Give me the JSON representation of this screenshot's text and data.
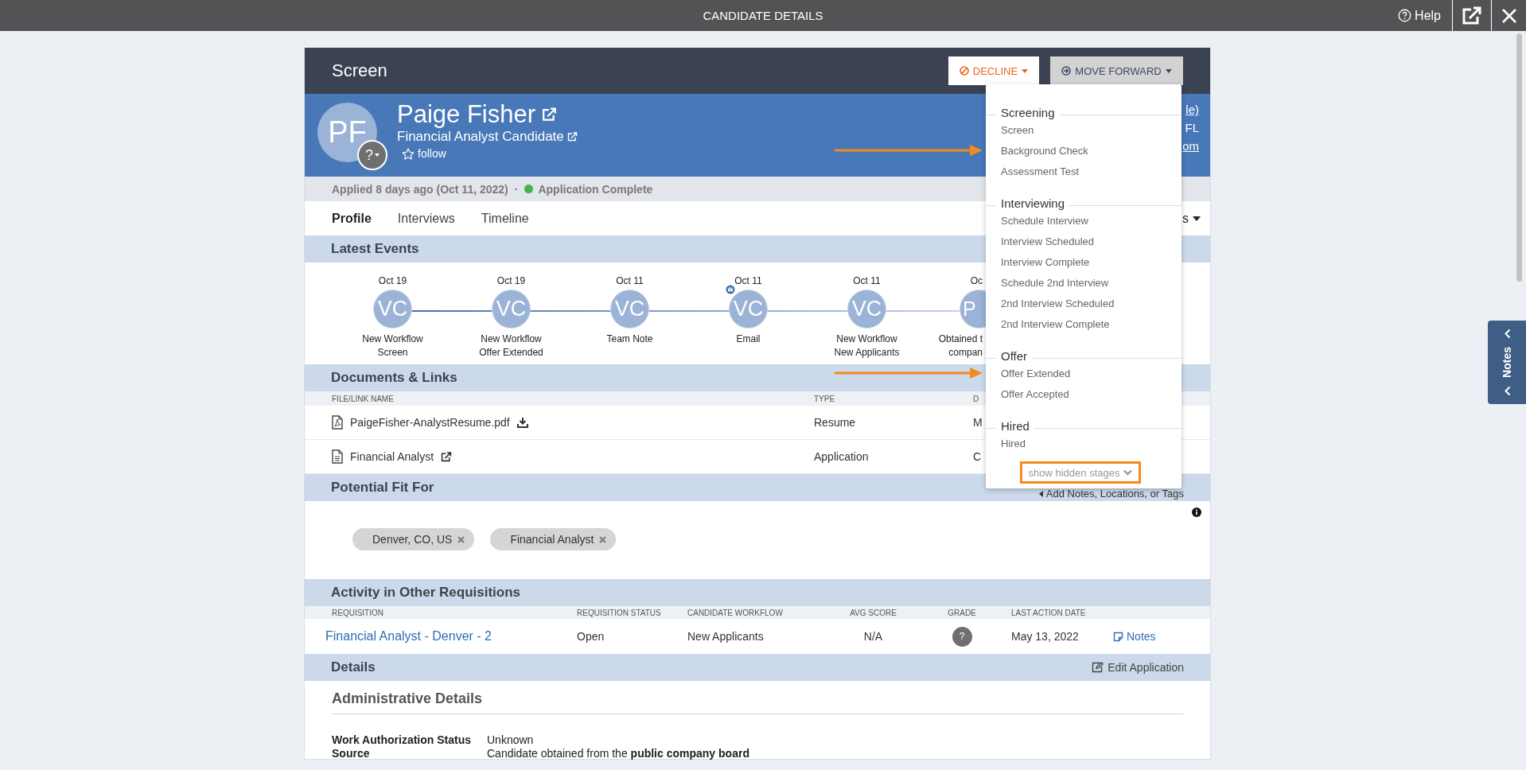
{
  "window": {
    "title": "CANDIDATE DETAILS",
    "help": "Help"
  },
  "stage_header": {
    "title": "Screen",
    "decline": "DECLINE",
    "move_forward": "MOVE FORWARD"
  },
  "candidate": {
    "initials": "PF",
    "grade_badge": "?",
    "name": "Paige Fisher",
    "title": "Financial Analyst Candidate",
    "follow": "follow",
    "contact_fragments": [
      "le)",
      "FL",
      "om"
    ]
  },
  "application": {
    "applied": "Applied 8 days ago (Oct 11, 2022)",
    "separator": "·",
    "status": "Application Complete"
  },
  "tabs": [
    {
      "label": "Profile",
      "selected": true
    },
    {
      "label": "Interviews",
      "selected": false
    },
    {
      "label": "Timeline",
      "selected": false
    }
  ],
  "tabs_menu_fragment": "s",
  "latest_events": {
    "title": "Latest Events",
    "events": [
      {
        "date": "Oct 19",
        "initials": "VC",
        "lines": [
          "New Workflow",
          "Screen"
        ],
        "badge": false
      },
      {
        "date": "Oct 19",
        "initials": "VC",
        "lines": [
          "New Workflow",
          "Offer Extended"
        ],
        "badge": false
      },
      {
        "date": "Oct 11",
        "initials": "VC",
        "lines": [
          "Team Note"
        ],
        "badge": false
      },
      {
        "date": "Oct 11",
        "initials": "VC",
        "lines": [
          "Email"
        ],
        "badge": true
      },
      {
        "date": "Oct 11",
        "initials": "VC",
        "lines": [
          "New Workflow",
          "New Applicants"
        ],
        "badge": false
      },
      {
        "date": "Oc",
        "initials": "P",
        "lines": [
          "Obtained t",
          "compan"
        ],
        "badge": false
      }
    ]
  },
  "documents": {
    "title": "Documents & Links",
    "columns": [
      "FILE/LINK NAME",
      "TYPE",
      "D"
    ],
    "rows": [
      {
        "kind": "pdf",
        "name": "PaigeFisher-AnalystResume.pdf",
        "type": "Resume",
        "column_3": "M"
      },
      {
        "kind": "form",
        "name": "Financial Analyst",
        "type": "Application",
        "column_3": "C"
      }
    ]
  },
  "potential_fit": {
    "title": "Potential Fit For",
    "action": "Add Notes, Locations, or Tags",
    "tags": [
      "Denver, CO, US",
      "Financial Analyst"
    ]
  },
  "activity": {
    "title": "Activity in Other Requisitions",
    "columns": [
      "REQUISITION",
      "REQUISITION STATUS",
      "CANDIDATE WORKFLOW",
      "AVG SCORE",
      "GRADE",
      "LAST ACTION DATE"
    ],
    "rows": [
      {
        "requisition": "Financial Analyst - Denver - 2",
        "status": "Open",
        "workflow": "New Applicants",
        "avg_score": "N/A",
        "grade": "?",
        "last_action": "May 13, 2022",
        "notes": "Notes"
      }
    ]
  },
  "details": {
    "title": "Details",
    "edit": "Edit Application",
    "section": "Administrative Details",
    "fields": [
      {
        "label": "Work Authorization Status",
        "value": "Unknown"
      },
      {
        "label": "Source",
        "value": "Candidate obtained from the **public company board**"
      }
    ]
  },
  "move_forward_menu": {
    "groups": [
      {
        "title": "Screening",
        "items": [
          {
            "label": "Screen",
            "marked": false
          },
          {
            "label": "Background Check",
            "marked": true
          },
          {
            "label": "Assessment Test",
            "marked": false
          }
        ]
      },
      {
        "title": "Interviewing",
        "items": [
          {
            "label": "Schedule Interview",
            "marked": false
          },
          {
            "label": "Interview Scheduled",
            "marked": false
          },
          {
            "label": "Interview Complete",
            "marked": false
          },
          {
            "label": "Schedule 2nd Interview",
            "marked": false
          },
          {
            "label": "2nd Interview Scheduled",
            "marked": false
          },
          {
            "label": "2nd Interview Complete",
            "marked": false
          }
        ]
      },
      {
        "title": "Offer",
        "items": [
          {
            "label": "Offer Extended",
            "marked": true
          },
          {
            "label": "Offer Accepted",
            "marked": false
          }
        ]
      },
      {
        "title": "Hired",
        "items": [
          {
            "label": "Hired",
            "marked": false
          }
        ]
      }
    ],
    "more": "show hidden stages",
    "more_highlighted": true
  },
  "notes_tab": "Notes"
}
